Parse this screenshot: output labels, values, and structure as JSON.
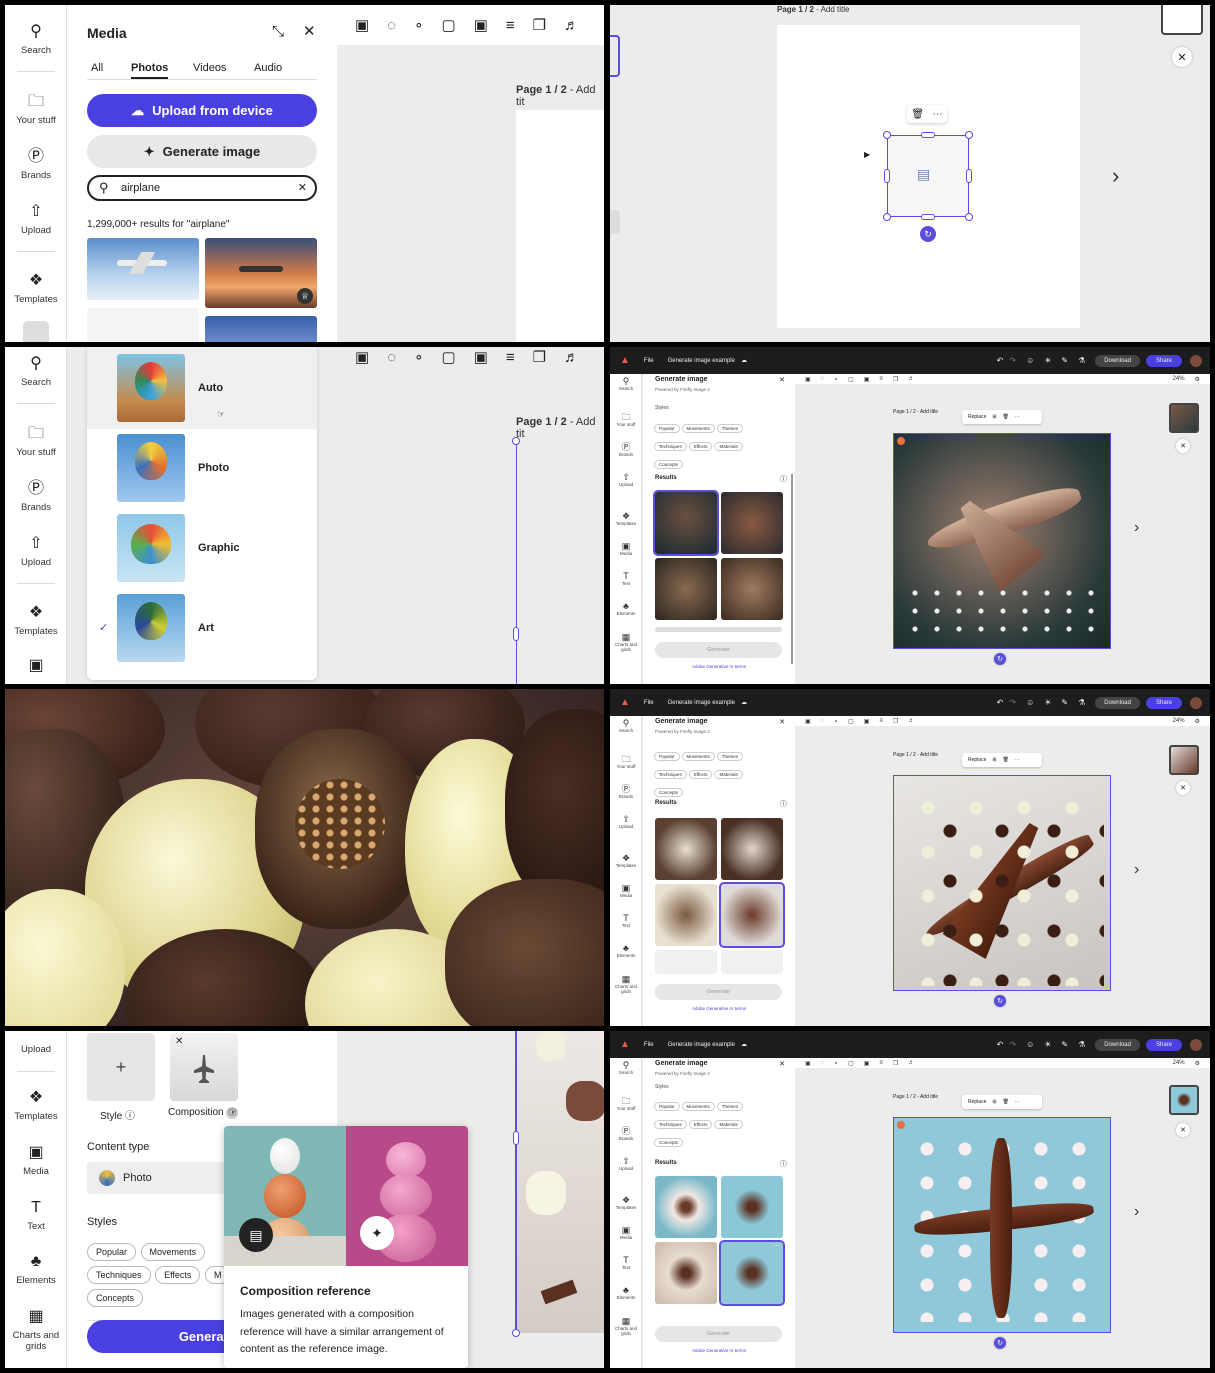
{
  "rail": {
    "search": "Search",
    "your_stuff": "Your stuff",
    "brands": "Brands",
    "upload": "Upload",
    "templates": "Templates",
    "media": "Media",
    "text": "Text",
    "elements": "Elements",
    "charts": "Charts and grids"
  },
  "p1": {
    "title": "Media",
    "tabs": [
      "All",
      "Photos",
      "Videos",
      "Audio"
    ],
    "upload_btn": "Upload from device",
    "generate_btn": "Generate image",
    "search_value": "airplane",
    "results_text": "1,299,000+ results for \"airplane\"",
    "page_label_bold": "Page 1 / 2",
    "page_label_rest": " - Add tit"
  },
  "p2": {
    "page_label_bold": "Page 1 / 2",
    "page_label_rest": " - Add title"
  },
  "p3": {
    "options": [
      "Auto",
      "Photo",
      "Graphic",
      "Art"
    ],
    "page_label_bold": "Page 1 / 2",
    "page_label_rest": " - Add tit"
  },
  "top": {
    "file": "File",
    "doc_title": "Generate image example",
    "download": "Download",
    "share": "Share"
  },
  "gen": {
    "title": "Generate image",
    "powered": "Powered by Firefly Image 3",
    "styles_label": "Styles",
    "chips": [
      "Popular",
      "Movements",
      "Themes",
      "Techniques",
      "Effects",
      "Materials",
      "Concepts"
    ],
    "results": "Results",
    "generate": "Generate",
    "terms": "Adobe Generative AI terms",
    "page_label": "Page 1 / 2 - Add title",
    "replace": "Replace",
    "zoom": "24%"
  },
  "p7": {
    "style_label": "Style",
    "composition_label": "Composition",
    "content_type_label": "Content type",
    "content_type_value": "Photo",
    "styles_label": "Styles",
    "chips": [
      "Popular",
      "Movements",
      "Techniques",
      "Effects",
      "M",
      "Concepts"
    ],
    "generate_btn": "Generate",
    "tooltip_title": "Composition reference",
    "tooltip_body": "Images generated with a composition reference will have a similar arrangement of content as the reference image."
  },
  "colors": {
    "accent": "#4a3fe0",
    "selection": "#5a4fd8"
  }
}
